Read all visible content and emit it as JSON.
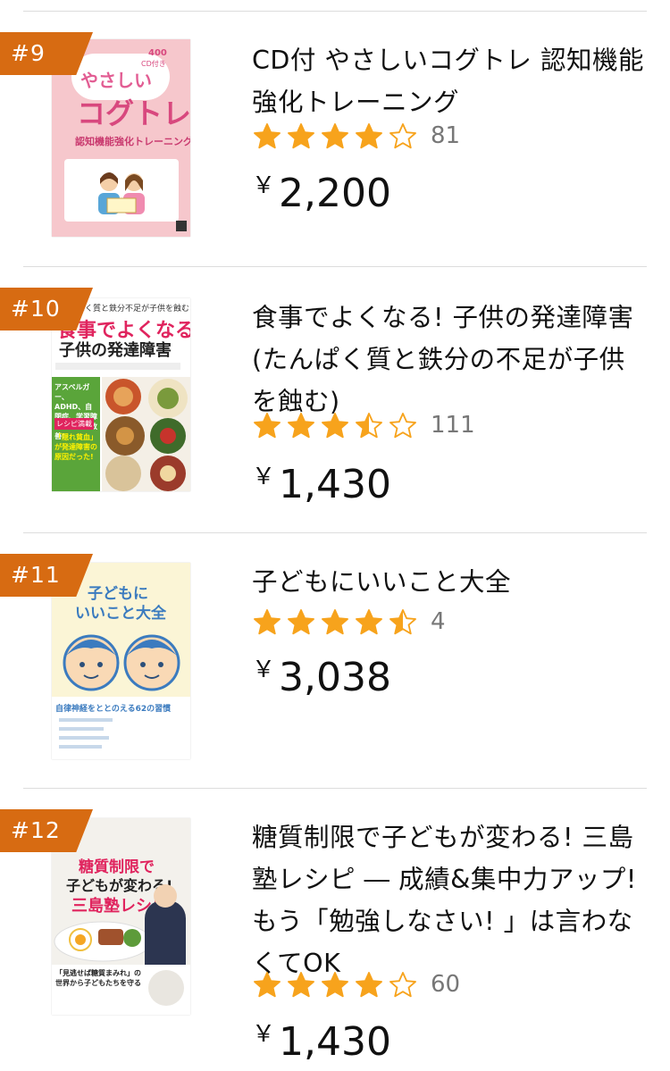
{
  "items": [
    {
      "rank": "#9",
      "title": "CD付 やさしいコグトレ 認知機能強化トレーニング",
      "rating": 4,
      "stars": [
        "full",
        "full",
        "full",
        "full",
        "empty"
      ],
      "review_count": "81",
      "currency": "￥",
      "price": "2,200",
      "cover": {
        "badge": "400",
        "line1": "やさしい",
        "line2": "コグトレ",
        "line3": "認知機能強化トレーニング",
        "tag": "CD付き"
      }
    },
    {
      "rank": "#10",
      "title": "食事でよくなる! 子供の発達障害 (たんぱく質と鉄分の不足が子供を蝕む)",
      "rating": 3.5,
      "stars": [
        "full",
        "full",
        "full",
        "half",
        "empty"
      ],
      "review_count": "111",
      "currency": "￥",
      "price": "1,430",
      "cover": {
        "top": "ぱく質と鉄分不足が子供を蝕む",
        "line1": "食事でよくなる!",
        "line2": "子供の発達障害",
        "side1": "アスペルガー、ADHD、自閉症、学習障害が続々と改善!",
        "side2": "レシピ満載",
        "side3": "「隠れ貧血」が発達障害の原因だった!"
      }
    },
    {
      "rank": "#11",
      "title": "子どもにいいこと大全",
      "rating": 4.5,
      "stars": [
        "full",
        "full",
        "full",
        "full",
        "half"
      ],
      "review_count": "4",
      "currency": "￥",
      "price": "3,038",
      "cover": {
        "line1": "子どもに",
        "line2": "いいこと大全",
        "sub": "自律神経をととのえる62の習慣"
      }
    },
    {
      "rank": "#12",
      "title": "糖質制限で子どもが変わる! 三島塾レシピ ― 成績&集中力アップ! もう「勉強しなさい! 」は言わなくてOK",
      "rating": 4,
      "stars": [
        "full",
        "full",
        "full",
        "full",
        "empty"
      ],
      "review_count": "60",
      "currency": "￥",
      "price": "1,430",
      "cover": {
        "line1": "糖質制限で",
        "line2": "子どもが変わる!",
        "line3": "三島塾レシピ",
        "sub": "「見逃せば糖質まみれ」の世界から子どもたちを守る"
      }
    }
  ],
  "colors": {
    "rank_badge": "#d76b12",
    "star": "#f7a31c",
    "divider": "#dddddd",
    "review_count": "#777777"
  }
}
